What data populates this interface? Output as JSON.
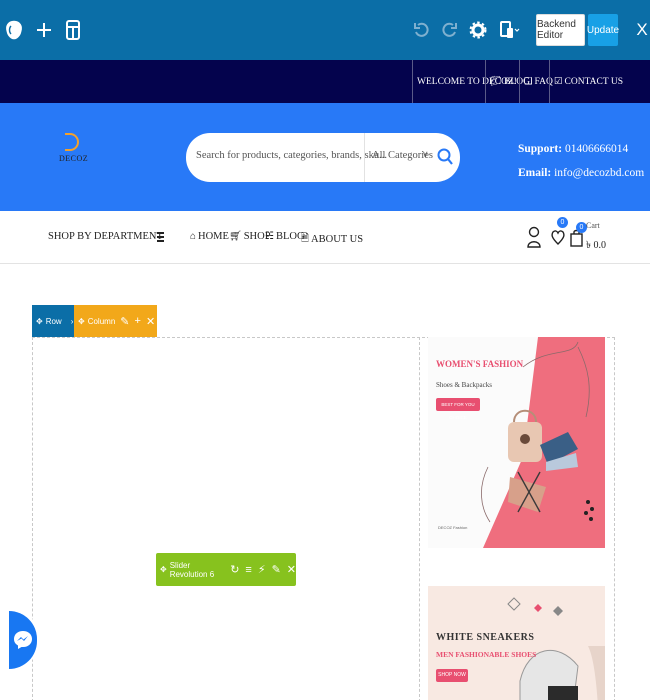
{
  "builder": {
    "backend_editor_label": "Backend Editor",
    "update_label": "Update",
    "close_glyph": "X",
    "icons": [
      "logo-icon",
      "add-icon",
      "templates-icon",
      "undo-icon",
      "redo-icon",
      "settings-icon",
      "responsive-icon"
    ]
  },
  "topbar": {
    "welcome": "WELCOME TO DECOZ!",
    "blog": "BLOG",
    "faq": "FAQ",
    "contact": "CONTACT US"
  },
  "header": {
    "logo_text": "DECOZ",
    "search_placeholder": "Search for products, categories, brands, sku...",
    "category_label": "All Categories",
    "support_label": "Support:",
    "support_phone": "01406666014",
    "email_label": "Email:",
    "email": "info@decozbd.com"
  },
  "nav": {
    "shop_by_department": "SHOP BY DEPARTMENT",
    "links": [
      "HOME",
      "SHOP",
      "BLOG",
      "ABOUT US"
    ],
    "wishlist_count": "0",
    "cart_count": "0",
    "cart_label": "Cart",
    "cart_amount": "৳ 0.0"
  },
  "editor": {
    "row_label": "Row",
    "column_label": "Column",
    "slider_label": "Slider Revolution 6"
  },
  "banners": {
    "banner1_title": "WOMEN'S FASHION",
    "banner1_subtitle": "Shoes & Backpacks",
    "banner1_button": "BEST FOR YOU CHOICE",
    "banner1_brand": "DECOZ Fashion",
    "banner2_title": "WHITE SNEAKERS",
    "banner2_subtitle": "MEN FASHIONABLE SHOES",
    "banner2_button": "SHOP NOW"
  },
  "colors": {
    "builder_bar": "#0b6ea7",
    "top_strip": "#04034d",
    "header": "#2879f7",
    "column_control": "#f2a81a",
    "slider_control": "#87c21e",
    "banner_accent": "#e84f70"
  }
}
